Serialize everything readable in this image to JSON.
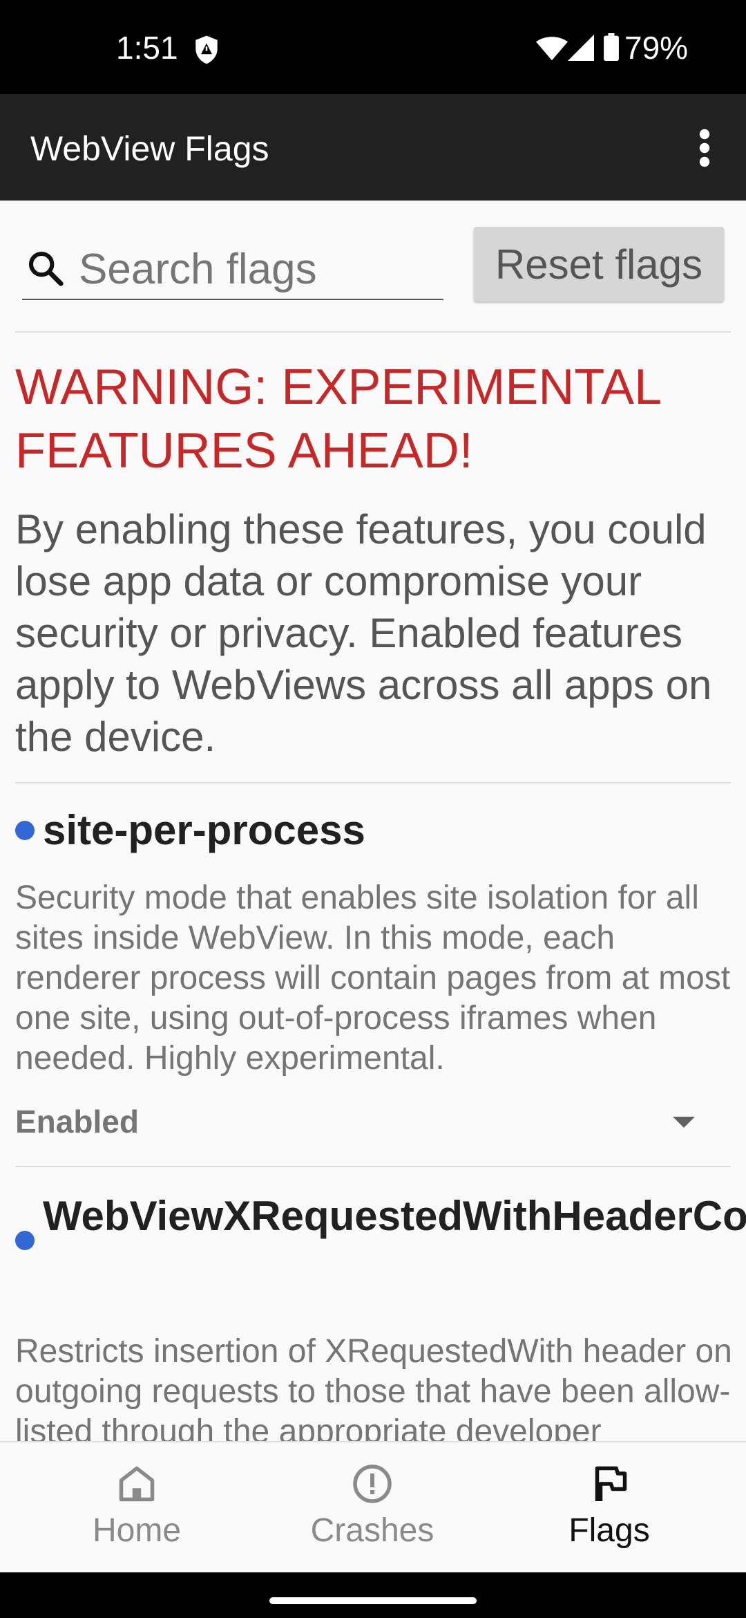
{
  "status_bar": {
    "time": "1:51",
    "battery_pct": "79%"
  },
  "app_bar": {
    "title": "WebView Flags"
  },
  "search": {
    "placeholder": "Search flags",
    "value": "",
    "reset_label": "Reset flags"
  },
  "warning": {
    "title": "WARNING: EXPERIMENTAL FEATURES AHEAD!",
    "body": "By enabling these features, you could lose app data or compromise your security or privacy. Enabled features apply to WebViews across all apps on the device."
  },
  "flags": [
    {
      "name": "site-per-process",
      "description": "Security mode that enables site isolation for all sites inside WebView. In this mode, each renderer process will contain pages from at most one site, using out-of-process iframes when needed. Highly experimental.",
      "state": "Enabled",
      "indicator_color": "#3367d6"
    },
    {
      "name": "WebViewXRequestedWithHeaderControl",
      "description": "Restricts insertion of XRequestedWith header on outgoing requests to those that have been allow-listed through the appropriate developer",
      "indicator_color": "#3367d6"
    }
  ],
  "bottom_nav": {
    "items": [
      {
        "label": "Home",
        "icon": "home-icon",
        "active": false
      },
      {
        "label": "Crashes",
        "icon": "crash-alert-icon",
        "active": false
      },
      {
        "label": "Flags",
        "icon": "flag-icon",
        "active": true
      }
    ]
  },
  "colors": {
    "warning": "#c62828",
    "app_bar": "#212121",
    "accent_dot": "#3367d6"
  }
}
